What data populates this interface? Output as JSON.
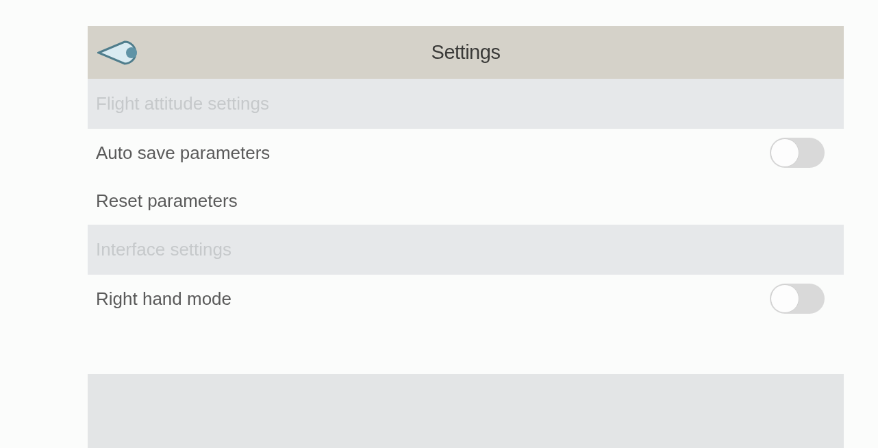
{
  "header": {
    "title": "Settings"
  },
  "items": [
    {
      "kind": "section",
      "label": "Flight attitude settings"
    },
    {
      "kind": "toggle",
      "label": "Auto save parameters",
      "on": false
    },
    {
      "kind": "action",
      "label": "Reset parameters"
    },
    {
      "kind": "section",
      "label": "Interface settings"
    },
    {
      "kind": "toggle",
      "label": "Right hand mode",
      "on": false
    }
  ]
}
